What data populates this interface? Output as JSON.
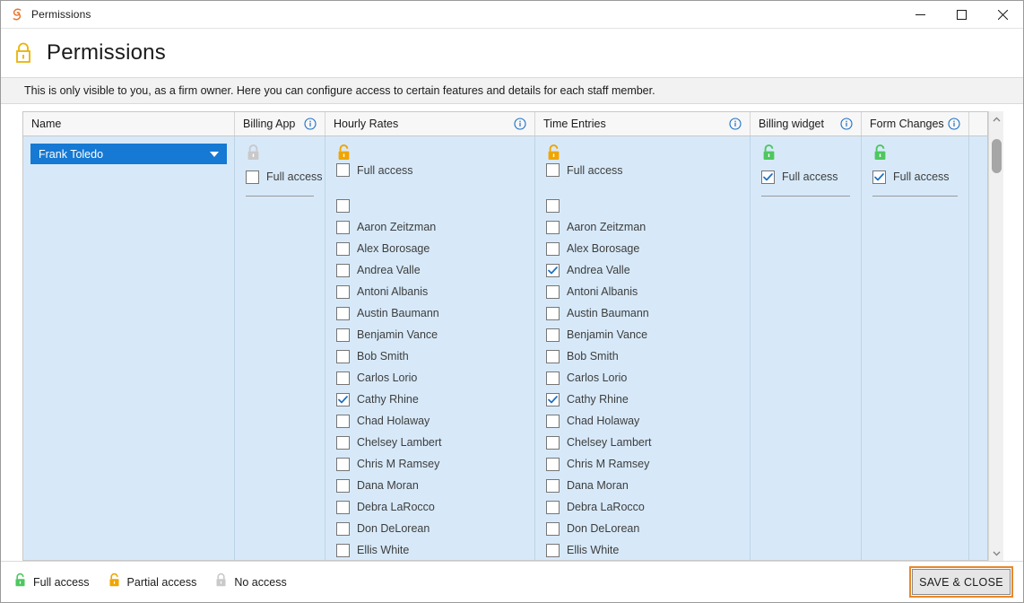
{
  "window": {
    "title": "Permissions",
    "app_icon": "spiral-s-icon",
    "controls": {
      "minimize": "minimize-icon",
      "maximize": "maximize-icon",
      "close": "close-icon"
    }
  },
  "page": {
    "lock_icon": "lock-closed-icon",
    "title": "Permissions",
    "banner": "This is only visible to you, as a firm owner. Here you can configure access to certain features and details for each staff member."
  },
  "grid": {
    "columns": [
      {
        "key": "name",
        "label": "Name",
        "info": false
      },
      {
        "key": "billapp",
        "label": "Billing App",
        "info": true
      },
      {
        "key": "hourly",
        "label": "Hourly Rates",
        "info": true
      },
      {
        "key": "time",
        "label": "Time Entries",
        "info": true
      },
      {
        "key": "widget",
        "label": "Billing widget",
        "info": true
      },
      {
        "key": "form",
        "label": "Form Changes",
        "info": true
      },
      {
        "key": "last",
        "label": "",
        "info": false
      }
    ],
    "selected_staff": "Frank Toledo",
    "full_access_label": "Full access",
    "access": {
      "billapp": {
        "lock": "no-access",
        "lock_color": "#c9c9c9",
        "full_access_checked": false,
        "has_name_list": false
      },
      "hourly": {
        "lock": "partial-access",
        "lock_color": "#f0a500",
        "full_access_checked": false,
        "has_name_list": true
      },
      "time": {
        "lock": "partial-access",
        "lock_color": "#f0a500",
        "full_access_checked": false,
        "has_name_list": true
      },
      "widget": {
        "lock": "full-access",
        "lock_color": "#4ec75f",
        "full_access_checked": true,
        "has_name_list": false
      },
      "form": {
        "lock": "full-access",
        "lock_color": "#4ec75f",
        "full_access_checked": true,
        "has_name_list": false
      }
    },
    "hourly_names": [
      {
        "label": "",
        "checked": false,
        "blank": true
      },
      {
        "label": "Aaron Zeitzman",
        "checked": false
      },
      {
        "label": "Alex Borosage",
        "checked": false
      },
      {
        "label": "Andrea Valle",
        "checked": false
      },
      {
        "label": "Antoni Albanis",
        "checked": false
      },
      {
        "label": "Austin Baumann",
        "checked": false
      },
      {
        "label": "Benjamin Vance",
        "checked": false
      },
      {
        "label": "Bob Smith",
        "checked": false
      },
      {
        "label": "Carlos Lorio",
        "checked": false
      },
      {
        "label": "Cathy Rhine",
        "checked": true
      },
      {
        "label": "Chad Holaway",
        "checked": false
      },
      {
        "label": "Chelsey Lambert",
        "checked": false
      },
      {
        "label": "Chris M Ramsey",
        "checked": false
      },
      {
        "label": "Dana Moran",
        "checked": false
      },
      {
        "label": "Debra LaRocco",
        "checked": false
      },
      {
        "label": "Don DeLorean",
        "checked": false
      },
      {
        "label": "Ellis White",
        "checked": false
      }
    ],
    "time_names": [
      {
        "label": "",
        "checked": false,
        "blank": true
      },
      {
        "label": "Aaron Zeitzman",
        "checked": false
      },
      {
        "label": "Alex Borosage",
        "checked": false
      },
      {
        "label": "Andrea Valle",
        "checked": true
      },
      {
        "label": "Antoni Albanis",
        "checked": false
      },
      {
        "label": "Austin Baumann",
        "checked": false
      },
      {
        "label": "Benjamin Vance",
        "checked": false
      },
      {
        "label": "Bob Smith",
        "checked": false
      },
      {
        "label": "Carlos Lorio",
        "checked": false
      },
      {
        "label": "Cathy Rhine",
        "checked": true
      },
      {
        "label": "Chad Holaway",
        "checked": false
      },
      {
        "label": "Chelsey Lambert",
        "checked": false
      },
      {
        "label": "Chris M Ramsey",
        "checked": false
      },
      {
        "label": "Dana Moran",
        "checked": false
      },
      {
        "label": "Debra LaRocco",
        "checked": false
      },
      {
        "label": "Don DeLorean",
        "checked": false
      },
      {
        "label": "Ellis White",
        "checked": false
      }
    ],
    "scrollbar": {
      "up": "chevron-up-icon",
      "down": "chevron-down-icon",
      "thumb_position_pct": 4
    }
  },
  "footer": {
    "legend": [
      {
        "label": "Full access",
        "icon": "lock-open-icon",
        "color": "#4ec75f"
      },
      {
        "label": "Partial access",
        "icon": "lock-open-icon",
        "color": "#f0a500"
      },
      {
        "label": "No access",
        "icon": "lock-closed-icon",
        "color": "#c9c9c9"
      }
    ],
    "save_label": "SAVE & CLOSE",
    "accent_color": "#e8882a"
  }
}
